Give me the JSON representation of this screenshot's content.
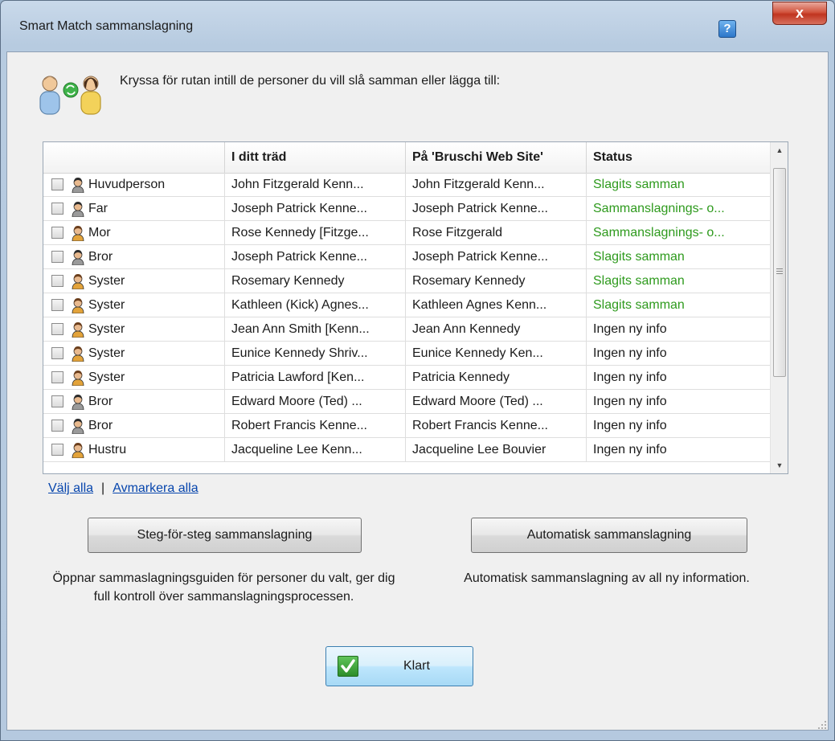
{
  "window": {
    "title": "Smart Match sammanslagning",
    "help_label": "?",
    "close_label": "x"
  },
  "instruction": "Kryssa för rutan intill de personer du vill slå samman eller lägga till:",
  "table": {
    "columns": [
      "",
      "I ditt träd",
      "På 'Bruschi Web Site'",
      "Status"
    ],
    "rows": [
      {
        "relation": "Huvudperson",
        "tree": "John Fitzgerald Kenn...",
        "site": "John Fitzgerald Kenn...",
        "status": "Slagits samman",
        "status_kind": "merged",
        "gender": "male"
      },
      {
        "relation": "Far",
        "tree": "Joseph Patrick Kenne...",
        "site": "Joseph Patrick Kenne...",
        "status": "Sammanslagnings- o...",
        "status_kind": "merged",
        "gender": "male"
      },
      {
        "relation": "Mor",
        "tree": "Rose Kennedy [Fitzge...",
        "site": "Rose Fitzgerald",
        "status": "Sammanslagnings- o...",
        "status_kind": "merged",
        "gender": "female"
      },
      {
        "relation": "Bror",
        "tree": "Joseph Patrick Kenne...",
        "site": "Joseph Patrick Kenne...",
        "status": "Slagits samman",
        "status_kind": "merged",
        "gender": "male"
      },
      {
        "relation": "Syster",
        "tree": "Rosemary Kennedy",
        "site": "Rosemary Kennedy",
        "status": "Slagits samman",
        "status_kind": "merged",
        "gender": "female"
      },
      {
        "relation": "Syster",
        "tree": "Kathleen (Kick) Agnes...",
        "site": "Kathleen Agnes Kenn...",
        "status": "Slagits samman",
        "status_kind": "merged",
        "gender": "female"
      },
      {
        "relation": "Syster",
        "tree": "Jean Ann Smith [Kenn...",
        "site": "Jean Ann Kennedy",
        "status": "Ingen ny info",
        "status_kind": "none",
        "gender": "female"
      },
      {
        "relation": "Syster",
        "tree": "Eunice Kennedy Shriv...",
        "site": "Eunice Kennedy Ken...",
        "status": "Ingen ny info",
        "status_kind": "none",
        "gender": "female"
      },
      {
        "relation": "Syster",
        "tree": "Patricia Lawford [Ken...",
        "site": "Patricia Kennedy",
        "status": "Ingen ny info",
        "status_kind": "none",
        "gender": "female"
      },
      {
        "relation": "Bror",
        "tree": "Edward Moore (Ted) ...",
        "site": "Edward Moore (Ted) ...",
        "status": "Ingen ny info",
        "status_kind": "none",
        "gender": "male"
      },
      {
        "relation": "Bror",
        "tree": "Robert Francis Kenne...",
        "site": "Robert Francis Kenne...",
        "status": "Ingen ny info",
        "status_kind": "none",
        "gender": "male"
      },
      {
        "relation": "Hustru",
        "tree": "Jacqueline Lee Kenn...",
        "site": "Jacqueline Lee Bouvier",
        "status": "Ingen ny info",
        "status_kind": "none",
        "gender": "female"
      }
    ]
  },
  "links": {
    "select_all": "Välj alla",
    "separator": "|",
    "deselect_all": "Avmarkera alla"
  },
  "buttons": {
    "step_label": "Steg-för-steg sammanslagning",
    "step_desc": "Öppnar sammaslagningsguiden för personer du valt, ger dig full kontroll över sammanslagningsprocessen.",
    "auto_label": "Automatisk sammanslagning",
    "auto_desc": "Automatisk sammanslagning av all ny information.",
    "done_label": "Klart"
  },
  "colors": {
    "merged_status": "#2e9a1d",
    "link": "#0645ad",
    "male_icon": "#9a9a9a",
    "female_icon": "#e3a33a"
  },
  "icons": {
    "header": "merge-persons-icon",
    "male": "male-person-icon",
    "female": "female-person-icon",
    "done": "checkmark-icon"
  }
}
